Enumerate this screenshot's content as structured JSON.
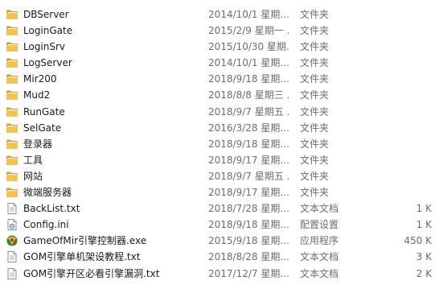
{
  "files": [
    {
      "name": "DBServer",
      "date": "2014/10/1 星期...",
      "type": "文件夹",
      "size": "",
      "icon": "folder-icon"
    },
    {
      "name": "LoginGate",
      "date": "2015/2/9 星期一 ...",
      "type": "文件夹",
      "size": "",
      "icon": "folder-icon"
    },
    {
      "name": "LoginSrv",
      "date": "2015/10/30 星期...",
      "type": "文件夹",
      "size": "",
      "icon": "folder-icon"
    },
    {
      "name": "LogServer",
      "date": "2014/10/1 星期...",
      "type": "文件夹",
      "size": "",
      "icon": "folder-icon"
    },
    {
      "name": "Mir200",
      "date": "2018/9/18 星期...",
      "type": "文件夹",
      "size": "",
      "icon": "folder-icon"
    },
    {
      "name": "Mud2",
      "date": "2018/8/8 星期三 ...",
      "type": "文件夹",
      "size": "",
      "icon": "folder-icon"
    },
    {
      "name": "RunGate",
      "date": "2018/9/7 星期五 ...",
      "type": "文件夹",
      "size": "",
      "icon": "folder-icon"
    },
    {
      "name": "SelGate",
      "date": "2016/3/28 星期...",
      "type": "文件夹",
      "size": "",
      "icon": "folder-icon"
    },
    {
      "name": "登录器",
      "date": "2018/9/18 星期...",
      "type": "文件夹",
      "size": "",
      "icon": "folder-icon"
    },
    {
      "name": "工具",
      "date": "2018/9/17 星期...",
      "type": "文件夹",
      "size": "",
      "icon": "folder-icon"
    },
    {
      "name": "网站",
      "date": "2018/9/7 星期五 ...",
      "type": "文件夹",
      "size": "",
      "icon": "folder-icon"
    },
    {
      "name": "微端服务器",
      "date": "2018/9/17 星期...",
      "type": "文件夹",
      "size": "",
      "icon": "folder-icon"
    },
    {
      "name": "BackList.txt",
      "date": "2018/7/28 星期...",
      "type": "文本文档",
      "size": "1 K",
      "icon": "text-file-icon"
    },
    {
      "name": "Config.ini",
      "date": "2018/9/18 星期...",
      "type": "配置设置",
      "size": "1 K",
      "icon": "config-file-icon"
    },
    {
      "name": "GameOfMir引擎控制器.exe",
      "date": "2015/9/18 星期...",
      "type": "应用程序",
      "size": "450 K",
      "icon": "application-icon"
    },
    {
      "name": "GOM引擎单机架设教程.txt",
      "date": "2018/8/28 星期...",
      "type": "文本文档",
      "size": "3 K",
      "icon": "text-file-icon"
    },
    {
      "name": "GOM引擎开区必看引擎漏洞.txt",
      "date": "2017/12/7 星期...",
      "type": "文本文档",
      "size": "2 K",
      "icon": "text-file-icon"
    }
  ],
  "colors": {
    "folder": "#e8b84a",
    "folder_dark": "#d69e2e",
    "detail_text": "#6d6d6d"
  }
}
